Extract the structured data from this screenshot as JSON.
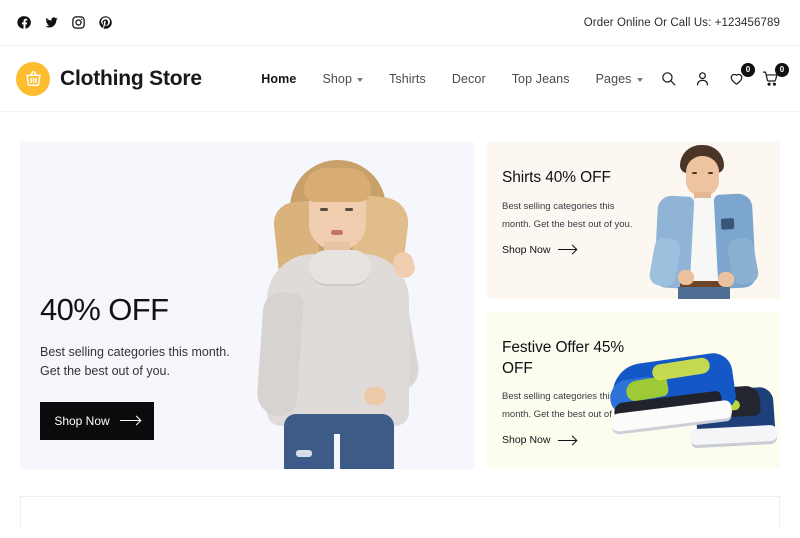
{
  "topbar": {
    "social": [
      {
        "name": "facebook-icon",
        "label": "Facebook"
      },
      {
        "name": "twitter-icon",
        "label": "Twitter"
      },
      {
        "name": "instagram-icon",
        "label": "Instagram"
      },
      {
        "name": "pinterest-icon",
        "label": "Pinterest"
      }
    ],
    "contact_text": "Order Online Or Call Us: +123456789"
  },
  "header": {
    "brand_name": "Clothing Store",
    "brand_icon": "shopping-basket-icon",
    "brand_color": "#febd2f",
    "nav": [
      {
        "label": "Home",
        "active": true,
        "has_caret": false
      },
      {
        "label": "Shop",
        "active": false,
        "has_caret": true
      },
      {
        "label": "Tshirts",
        "active": false,
        "has_caret": false
      },
      {
        "label": "Decor",
        "active": false,
        "has_caret": false
      },
      {
        "label": "Top Jeans",
        "active": false,
        "has_caret": false
      },
      {
        "label": "Pages",
        "active": false,
        "has_caret": true
      }
    ],
    "actions": {
      "search_icon": "search-icon",
      "account_icon": "user-icon",
      "wishlist_icon": "heart-icon",
      "wishlist_count": "0",
      "cart_icon": "cart-icon",
      "cart_count": "0"
    }
  },
  "hero": {
    "main": {
      "bg_color": "#f6f7fc",
      "title": "40% OFF",
      "subtitle": "Best selling categories this month. Get the best out of you.",
      "cta_label": "Shop Now",
      "image_alt": "woman-in-grey-sweater"
    },
    "cards": [
      {
        "bg_color": "#fdf7f1",
        "title": "Shirts 40% OFF",
        "subtitle": "Best selling categories this month. Get the best out of you.",
        "cta_label": "Shop Now",
        "image_alt": "man-in-denim-jacket"
      },
      {
        "bg_color": "#fdfdef",
        "title": "Festive Offer 45% OFF",
        "subtitle": "Best selling categories this month. Get the best out of you.",
        "cta_label": "Shop Now",
        "image_alt": "blue-running-shoes"
      }
    ]
  }
}
